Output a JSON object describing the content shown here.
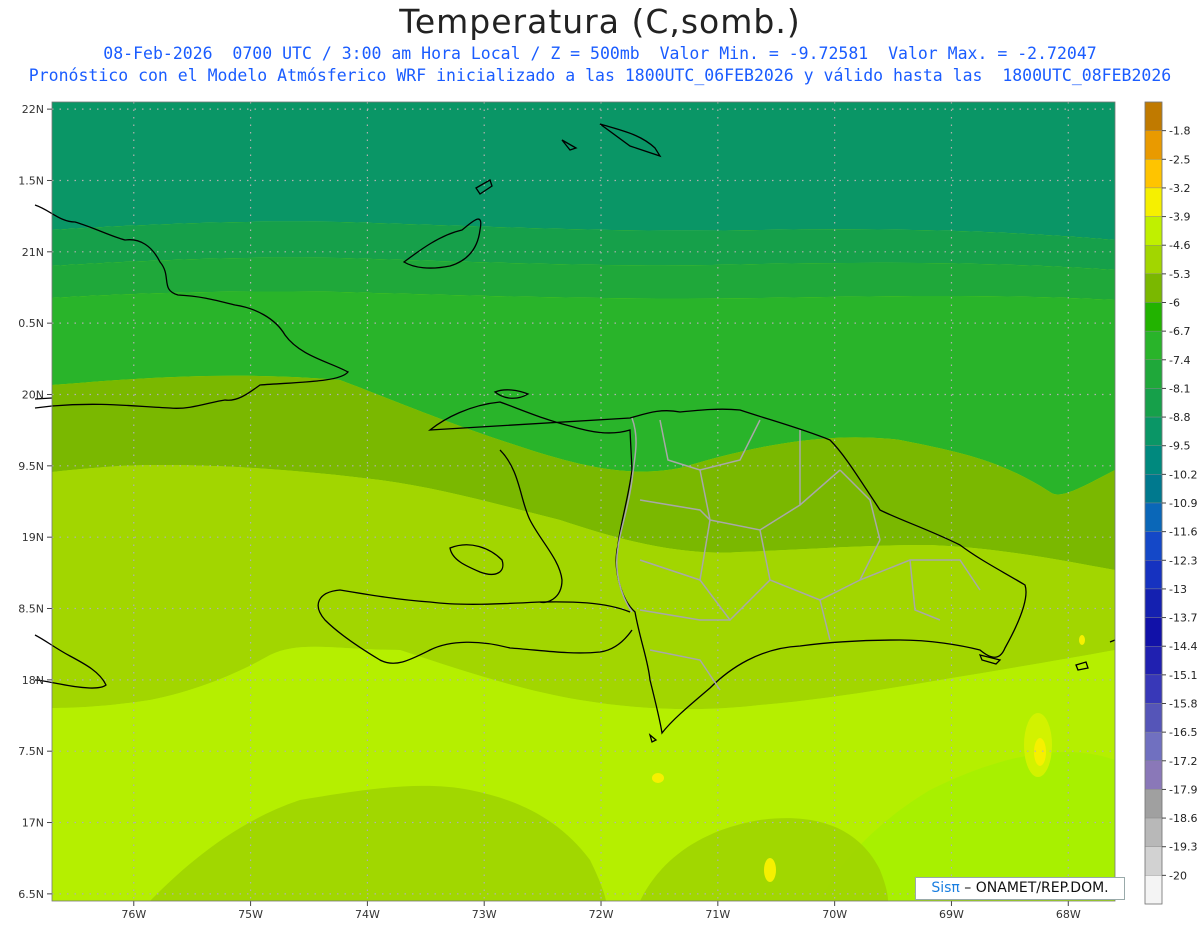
{
  "title": "Temperatura (C,somb.)",
  "subtitle_line1": "08-Feb-2026  0700 UTC / 3:00 am Hora Local / Z = 500mb  Valor Min. = -9.72581  Valor Max. = -2.72047",
  "subtitle_line2": "Pronóstico con el Modelo Atmósferico WRF inicializado a las 1800UTC_06FEB2026 y válido hasta las  1800UTC_08FEB2026",
  "credit": {
    "logo": "Sisπ",
    "text": " – ONAMET/REP.DOM."
  },
  "map": {
    "lon_range": [
      -76.7,
      -67.6
    ],
    "lat_range": [
      16.45,
      22.05
    ],
    "lat_ticks": [
      {
        "lat": 22.0,
        "label": "22N"
      },
      {
        "lat": 21.5,
        "label": "1.5N"
      },
      {
        "lat": 21.0,
        "label": "21N"
      },
      {
        "lat": 20.5,
        "label": "0.5N"
      },
      {
        "lat": 20.0,
        "label": "20N"
      },
      {
        "lat": 19.5,
        "label": "9.5N"
      },
      {
        "lat": 19.0,
        "label": "19N"
      },
      {
        "lat": 18.5,
        "label": "8.5N"
      },
      {
        "lat": 18.0,
        "label": "18N"
      },
      {
        "lat": 17.5,
        "label": "7.5N"
      },
      {
        "lat": 17.0,
        "label": "17N"
      },
      {
        "lat": 16.5,
        "label": "6.5N"
      }
    ],
    "lon_ticks": [
      {
        "lon": -76,
        "label": "76W"
      },
      {
        "lon": -75,
        "label": "75W"
      },
      {
        "lon": -74,
        "label": "74W"
      },
      {
        "lon": -73,
        "label": "73W"
      },
      {
        "lon": -72,
        "label": "72W"
      },
      {
        "lon": -71,
        "label": "71W"
      },
      {
        "lon": -70,
        "label": "70W"
      },
      {
        "lon": -69,
        "label": "69W"
      },
      {
        "lon": -68,
        "label": "68W"
      }
    ]
  },
  "colorbar": {
    "labels": [
      "-1.8",
      "-2.5",
      "-3.2",
      "-3.9",
      "-4.6",
      "-5.3",
      "-6",
      "-6.7",
      "-7.4",
      "-8.1",
      "-8.8",
      "-9.5",
      "-10.2",
      "-10.9",
      "-11.6",
      "-12.3",
      "-13",
      "-13.7",
      "-14.4",
      "-15.1",
      "-15.8",
      "-16.5",
      "-17.2",
      "-17.9",
      "-18.6",
      "-19.3",
      "-20"
    ],
    "colors": [
      "#c07a00",
      "#e99a00",
      "#ffc400",
      "#f6f000",
      "#c0f000",
      "#a2d600",
      "#7ab800",
      "#22b300",
      "#29b42a",
      "#1fa83a",
      "#16a04a",
      "#0a9666",
      "#00897e",
      "#00798e",
      "#0a67b8",
      "#1448c8",
      "#1632c0",
      "#1420b0",
      "#1111a8",
      "#2020b0",
      "#3838b8",
      "#5555b8",
      "#7070c0",
      "#8a78b8",
      "#a0a0a0",
      "#b8b8b8",
      "#d2d2d2",
      "#f4f4f4"
    ]
  }
}
